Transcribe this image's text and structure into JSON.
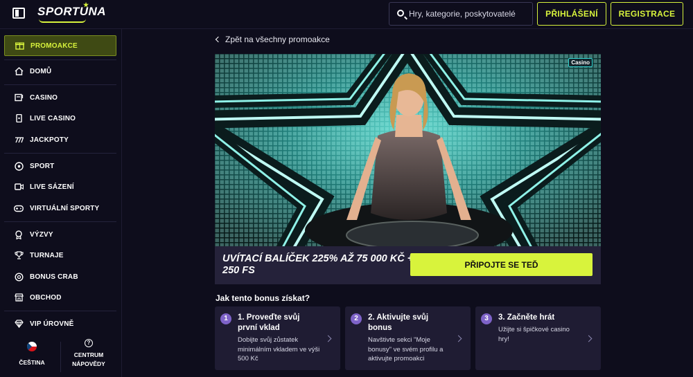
{
  "header": {
    "brand": "SPORTUNA",
    "search_placeholder": "Hry, kategorie, poskytovatelé",
    "login_label": "PŘIHLÁŠENÍ",
    "register_label": "REGISTRACE"
  },
  "sidebar": {
    "items": [
      {
        "label": "PROMOAKCE",
        "icon": "gift-icon"
      },
      {
        "label": "DOMŮ",
        "icon": "home-icon"
      },
      {
        "label": "CASINO",
        "icon": "slot-machine-icon"
      },
      {
        "label": "LIVE CASINO",
        "icon": "card-icon"
      },
      {
        "label": "JACKPOTY",
        "icon": "jackpot-icon"
      },
      {
        "label": "SPORT",
        "icon": "soccer-ball-icon"
      },
      {
        "label": "LIVE SÁZENÍ",
        "icon": "live-video-icon"
      },
      {
        "label": "VIRTUÁLNÍ SPORTY",
        "icon": "gamepad-icon"
      },
      {
        "label": "VÝZVY",
        "icon": "medal-icon"
      },
      {
        "label": "TURNAJE",
        "icon": "trophy-icon"
      },
      {
        "label": "BONUS CRAB",
        "icon": "crab-icon"
      },
      {
        "label": "OBCHOD",
        "icon": "shop-icon"
      },
      {
        "label": "VIP ÚROVNĚ",
        "icon": "diamond-icon"
      }
    ],
    "language": "ČEŠTINA",
    "help_line1": "CENTRUM",
    "help_line2": "NÁPOVĚDY"
  },
  "main": {
    "back_label": "Zpět na všechny promoakce",
    "tag": "Casino",
    "promo_title": "UVÍTACÍ BALÍČEK 225% AŽ 75 000 KČ + 250 FS",
    "join_label": "PŘIPOJTE SE TEĎ",
    "how_title": "Jak tento bonus získat?",
    "steps": [
      {
        "num": "1",
        "title": "1. Proveďte svůj první vklad",
        "desc": "Dobijte svůj zůstatek minimálním vkladem ve výši 500 Kč"
      },
      {
        "num": "2",
        "title": "2. Aktivujte svůj bonus",
        "desc": "Navštivte sekci \"Moje bonusy\" ve svém profilu a aktivujte promoakci"
      },
      {
        "num": "3",
        "title": "3. Začněte hrát",
        "desc": "Užijte si špičkové casino hry!"
      }
    ]
  },
  "colors": {
    "accent": "#d8f33c",
    "background": "#0e0d1c",
    "card": "#1f1c33",
    "step_badge": "#7e63c8",
    "teal": "#31d3d0"
  }
}
